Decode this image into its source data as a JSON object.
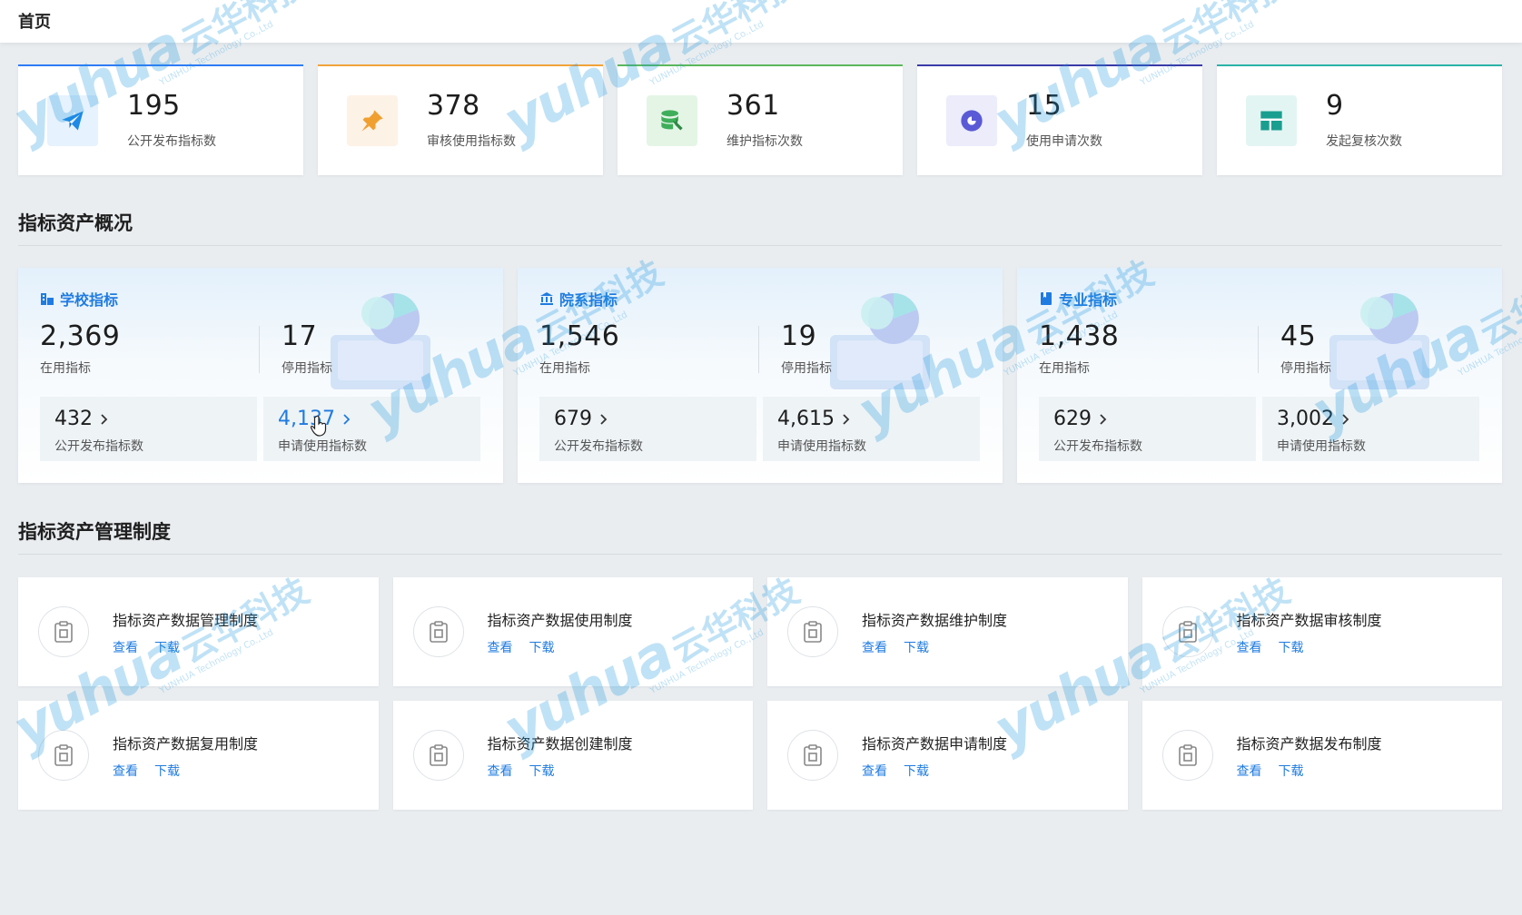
{
  "header": {
    "breadcrumb": "首页"
  },
  "stats": [
    {
      "value": "195",
      "label": "公开发布指标数",
      "icon": "paper-plane-icon",
      "accent": "#2f7cf6",
      "icon_bg": "#e6f2fd",
      "icon_color": "#1e8ae6"
    },
    {
      "value": "378",
      "label": "审核使用指标数",
      "icon": "pin-icon",
      "accent": "#f2a33a",
      "icon_bg": "#fdf2e6",
      "icon_color": "#f0a030"
    },
    {
      "value": "361",
      "label": "维护指标次数",
      "icon": "database-wrench-icon",
      "accent": "#5cb85c",
      "icon_bg": "#e4f5e6",
      "icon_color": "#3fae5a"
    },
    {
      "value": "15",
      "label": "使用申请次数",
      "icon": "pie-chart-icon",
      "accent": "#3a3aa8",
      "icon_bg": "#ececfb",
      "icon_color": "#5a5ad6"
    },
    {
      "value": "9",
      "label": "发起复核次数",
      "icon": "dashboard-layout-icon",
      "accent": "#2ab3a6",
      "icon_bg": "#e3f5f3",
      "icon_color": "#1a9e90"
    }
  ],
  "overview": {
    "title": "指标资产概况",
    "cards": [
      {
        "title": "学校指标",
        "icon": "building-icon",
        "in_use": "2,369",
        "in_use_label": "在用指标",
        "stopped": "17",
        "stopped_label": "停用指标",
        "published": "432",
        "published_label": "公开发布指标数",
        "applied": "4,137",
        "applied_label": "申请使用指标数"
      },
      {
        "title": "院系指标",
        "icon": "institution-icon",
        "in_use": "1,546",
        "in_use_label": "在用指标",
        "stopped": "19",
        "stopped_label": "停用指标",
        "published": "679",
        "published_label": "公开发布指标数",
        "applied": "4,615",
        "applied_label": "申请使用指标数"
      },
      {
        "title": "专业指标",
        "icon": "book-icon",
        "in_use": "1,438",
        "in_use_label": "在用指标",
        "stopped": "45",
        "stopped_label": "停用指标",
        "published": "629",
        "published_label": "公开发布指标数",
        "applied": "3,002",
        "applied_label": "申请使用指标数"
      }
    ]
  },
  "policies": {
    "title": "指标资产管理制度",
    "view_label": "查看",
    "download_label": "下载",
    "items": [
      "指标资产数据管理制度",
      "指标资产数据使用制度",
      "指标资产数据维护制度",
      "指标资产数据审核制度",
      "指标资产数据复用制度",
      "指标资产数据创建制度",
      "指标资产数据申请制度",
      "指标资产数据发布制度"
    ]
  },
  "watermark": {
    "logo": "yuhua",
    "cn": "云华科技",
    "en": "YUNHUA Technology Co.,Ltd"
  }
}
